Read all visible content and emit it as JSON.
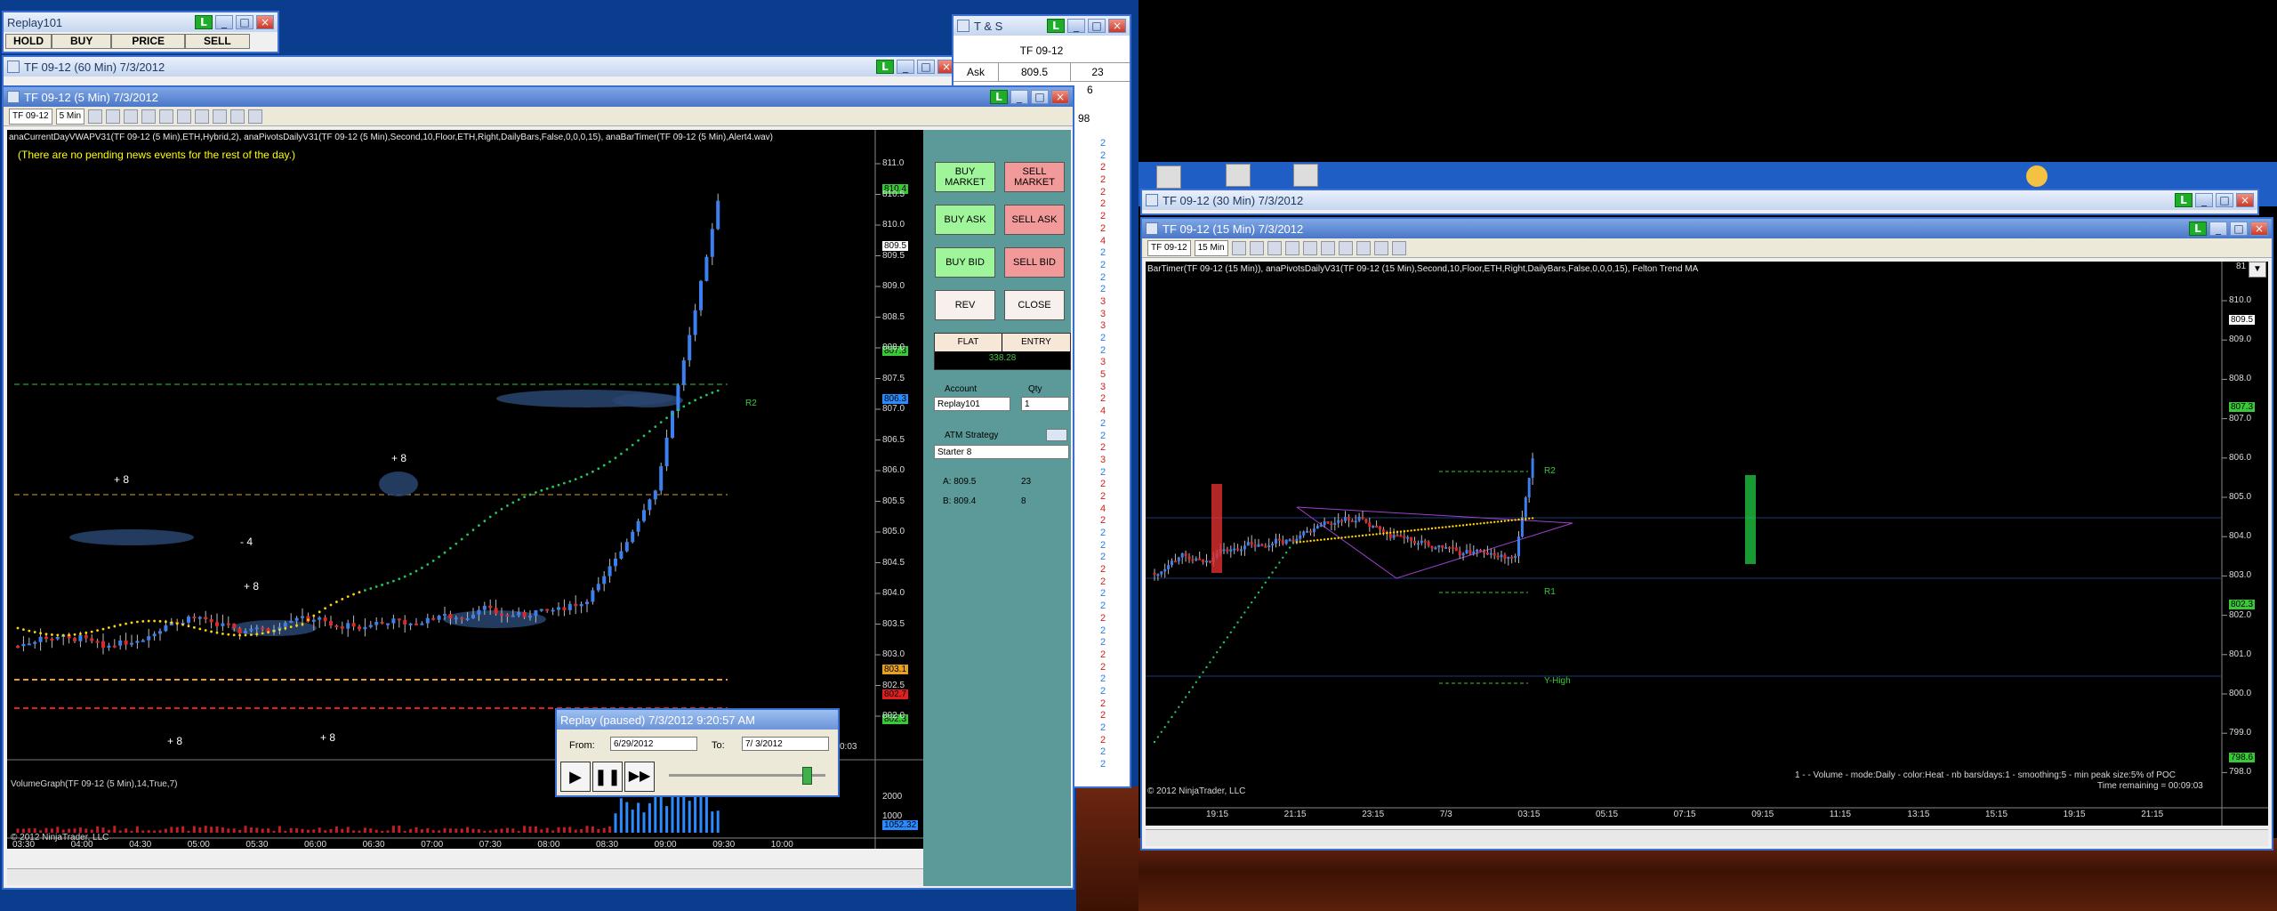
{
  "replay_bar": {
    "title": "Replay101",
    "buttons": [
      "HOLD",
      "BUY",
      "PRICE",
      "SELL"
    ]
  },
  "window_60min": {
    "title": "TF 09-12 (60 Min)  7/3/2012"
  },
  "window_5min": {
    "title": "TF 09-12 (5 Min)  7/3/2012",
    "toolbar_instrument": "TF 09-12",
    "toolbar_interval": "5 Min",
    "indicators": "anaCurrentDayVWAPV31(TF 09-12 (5 Min),ETH,Hybrid,2), anaPivotsDailyV31(TF 09-12 (5 Min),Second,10,Floor,ETH,Right,DailyBars,False,0,0,0,15), anaBarTimer(TF 09-12 (5 Min),Alert4.wav)",
    "news": "(There are no pending news events for the rest of the day.)",
    "price_ticks": [
      "811.0",
      "810.5",
      "810.0",
      "809.5",
      "809.0",
      "808.5",
      "808.0",
      "807.5",
      "807.0",
      "806.5",
      "806.0",
      "805.5",
      "805.0",
      "804.5",
      "804.0",
      "803.5",
      "803.0",
      "802.5",
      "802.0"
    ],
    "price_tags": [
      {
        "text": "810.4",
        "color": "#39c838"
      },
      {
        "text": "809.5",
        "color": "#ffffff"
      },
      {
        "text": "807.3",
        "color": "#39c838"
      },
      {
        "text": "806.3",
        "color": "#2a8bff"
      },
      {
        "text": "803.1",
        "color": "#e8a020"
      },
      {
        "text": "802.7",
        "color": "#e02020"
      },
      {
        "text": "802.3",
        "color": "#39c838"
      }
    ],
    "annotations": [
      "+ 8",
      "+ 8",
      "- 4",
      "+ 8",
      "+ 8",
      "+ 8"
    ],
    "r2_label": "R2",
    "time_labels": [
      "03:30",
      "04:00",
      "04:30",
      "05:00",
      "05:30",
      "06:00",
      "06:30",
      "07:00",
      "07:30",
      "08:00",
      "08:30",
      "09:00",
      "09:30",
      "10:00"
    ],
    "copyright": "© 2012 NinjaTrader, LLC",
    "volume_panel_label": "VolumeGraph(TF 09-12 (5 Min),14,True,7)",
    "volume_ticks": [
      "2000",
      "1000"
    ],
    "volume_tag": "1052.32",
    "timer_label": "0:03"
  },
  "order_panel": {
    "buttons": [
      {
        "label": "BUY MARKET",
        "style": "green"
      },
      {
        "label": "SELL MARKET",
        "style": "red"
      },
      {
        "label": "BUY ASK",
        "style": "green"
      },
      {
        "label": "SELL ASK",
        "style": "red"
      },
      {
        "label": "BUY BID",
        "style": "green"
      },
      {
        "label": "SELL BID",
        "style": "red"
      },
      {
        "label": "REV",
        "style": "white"
      },
      {
        "label": "CLOSE",
        "style": "white"
      }
    ],
    "position_label": "FLAT",
    "entry_label": "ENTRY",
    "pnl": "338.28",
    "account_label": "Account",
    "qty_label": "Qty",
    "account": "Replay101",
    "qty": "1",
    "atm_label": "ATM Strategy",
    "atm_value": "Starter 8",
    "ask_label": "A: 809.5",
    "ask_size": "23",
    "bid_label": "B: 809.4",
    "bid_size": "8"
  },
  "replay_dialog": {
    "title": "Replay (paused) 7/3/2012 9:20:57 AM",
    "from_label": "From:",
    "from_value": "6/29/2012",
    "to_label": "To:",
    "to_value": "7/ 3/2012"
  },
  "time_and_sales": {
    "title": "T & S",
    "instrument": "TF 09-12",
    "ask_label": "Ask",
    "ask_price": "809.5",
    "ask_size": "23",
    "bid_size": "6",
    "row3": "98",
    "sizes": [
      "2",
      "2",
      "2",
      "2",
      "2",
      "2",
      "2",
      "2",
      "4",
      "2",
      "2",
      "2",
      "2",
      "3",
      "3",
      "3",
      "2",
      "2",
      "3",
      "5",
      "3",
      "2",
      "4",
      "2",
      "2",
      "2",
      "3",
      "2",
      "2",
      "2",
      "4",
      "2",
      "2",
      "2",
      "2",
      "2",
      "2",
      "2",
      "2",
      "2",
      "2",
      "2",
      "2",
      "2",
      "2",
      "2",
      "2",
      "2",
      "2",
      "2",
      "2",
      "2"
    ],
    "size_colors": [
      "#2a7de0",
      "#2a7de0",
      "#d02020",
      "#d02020",
      "#d02020",
      "#d02020",
      "#d02020",
      "#d02020",
      "#d02020",
      "#2a7de0",
      "#2a7de0",
      "#2a7de0",
      "#2a7de0",
      "#d02020",
      "#d02020",
      "#d02020",
      "#2a7de0",
      "#2a7de0",
      "#d02020",
      "#d02020",
      "#d02020",
      "#d02020",
      "#d02020",
      "#2a7de0",
      "#2a7de0",
      "#d02020",
      "#d02020",
      "#2a7de0",
      "#d02020",
      "#d02020",
      "#d02020",
      "#d02020",
      "#2a7de0",
      "#2a7de0",
      "#2a7de0",
      "#d02020",
      "#d02020",
      "#2a7de0",
      "#2a7de0",
      "#d02020",
      "#2a7de0",
      "#2a7de0",
      "#d02020",
      "#d02020",
      "#2a7de0",
      "#2a7de0",
      "#d02020",
      "#d02020",
      "#2a7de0",
      "#d02020",
      "#2a7de0",
      "#2a7de0"
    ]
  },
  "window_30min": {
    "title": "TF 09-12 (30 Min)  7/3/2012"
  },
  "window_15min": {
    "title": "TF 09-12 (15 Min)  7/3/2012",
    "toolbar_instrument": "TF 09-12",
    "toolbar_interval": "15 Min",
    "indicators": "BarTimer(TF 09-12 (15 Min)), anaPivotsDailyV31(TF 09-12 (15 Min),Second,10,Floor,ETH,Right,DailyBars,False,0,0,0,15), Felton Trend MA",
    "price_ticks": [
      "810.0",
      "809.0",
      "808.0",
      "807.0",
      "806.0",
      "805.0",
      "804.0",
      "803.0",
      "802.0",
      "801.0",
      "800.0",
      "799.0",
      "798.0"
    ],
    "price_tags": [
      {
        "text": "809.5",
        "color": "#ffffff"
      },
      {
        "text": "807.3",
        "color": "#39c838"
      },
      {
        "text": "802.3",
        "color": "#39c838"
      },
      {
        "text": "798.6",
        "color": "#39c838"
      }
    ],
    "level_labels": [
      "R2",
      "R1",
      "Y-High"
    ],
    "time_labels": [
      "19:15",
      "21:15",
      "23:15",
      "7/3",
      "03:15",
      "05:15",
      "07:15",
      "09:15",
      "11:15",
      "13:15",
      "15:15",
      "19:15",
      "21:15"
    ],
    "copyright": "© 2012 NinjaTrader, LLC",
    "profile_text": "1 -  - Volume - mode:Daily - color:Heat - nb bars/days:1 - smoothing:5 - min peak size:5% of POC",
    "time_remaining": "Time remaining = 00:09:03",
    "top_tick": "81"
  }
}
